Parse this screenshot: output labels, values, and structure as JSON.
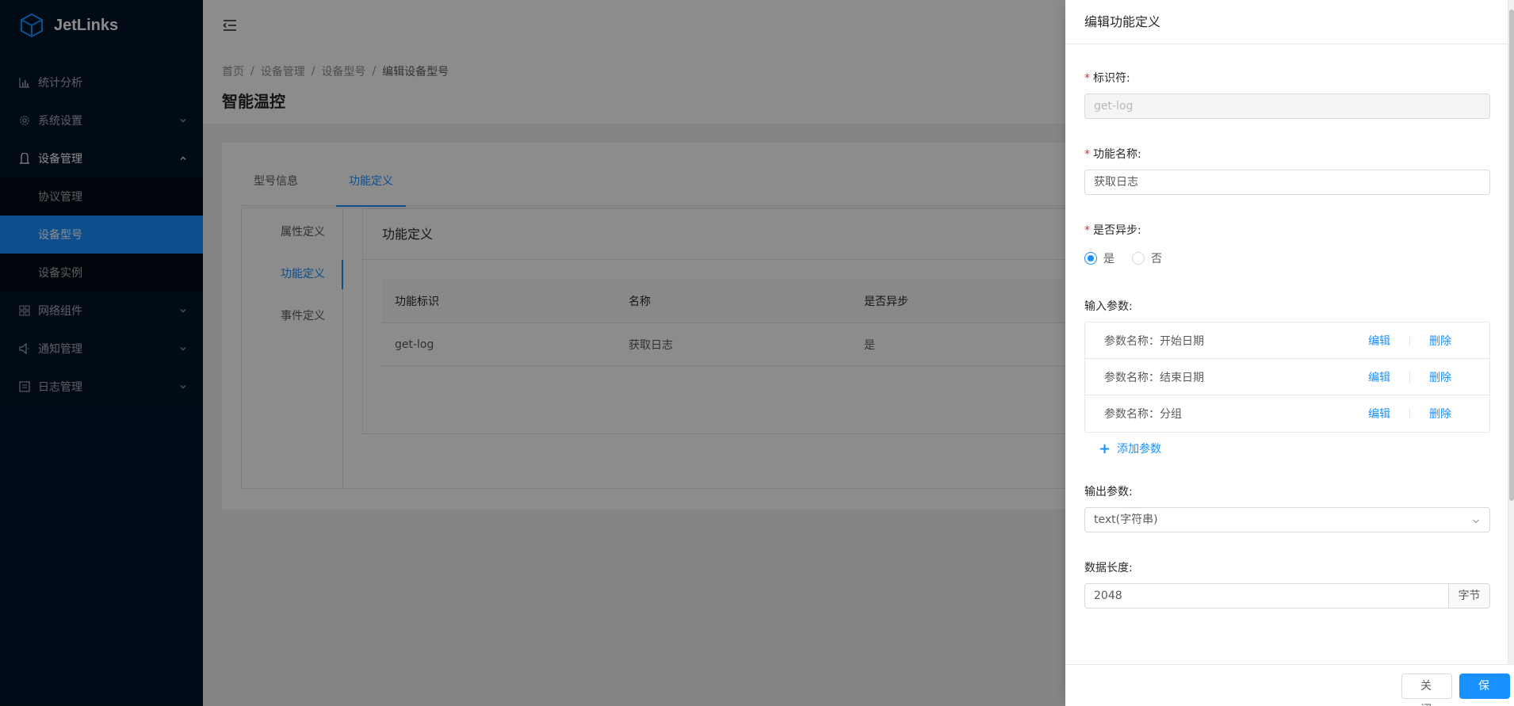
{
  "app": {
    "logo_text": "JetLinks"
  },
  "sidebar": {
    "items": [
      {
        "label": "统计分析",
        "icon": "bar-chart-icon"
      },
      {
        "label": "系统设置",
        "icon": "gear-icon"
      },
      {
        "label": "设备管理",
        "icon": "user-icon"
      },
      {
        "label": "网络组件",
        "icon": "appstore-icon"
      },
      {
        "label": "通知管理",
        "icon": "sound-icon"
      },
      {
        "label": "日志管理",
        "icon": "log-icon"
      }
    ],
    "sub_items": [
      {
        "label": "协议管理"
      },
      {
        "label": "设备型号"
      },
      {
        "label": "设备实例"
      }
    ]
  },
  "breadcrumb": [
    "首页",
    "设备管理",
    "设备型号",
    "编辑设备型号"
  ],
  "page": {
    "title": "智能温控"
  },
  "tabs": [
    "型号信息",
    "功能定义"
  ],
  "vtabs": [
    "属性定义",
    "功能定义",
    "事件定义"
  ],
  "function_card": {
    "title": "功能定义",
    "columns": [
      "功能标识",
      "名称",
      "是否异步"
    ],
    "rows": [
      {
        "id": "get-log",
        "name": "获取日志",
        "async": "是"
      }
    ]
  },
  "drawer": {
    "title": "编辑功能定义",
    "identifier": {
      "label": "标识符:",
      "value": "get-log"
    },
    "name": {
      "label": "功能名称:",
      "value": "获取日志"
    },
    "async": {
      "label": "是否异步:",
      "options": [
        "是",
        "否"
      ],
      "selected": "是"
    },
    "input_params": {
      "label": "输入参数:",
      "items": [
        {
          "label": "参数名称：开始日期"
        },
        {
          "label": "参数名称：结束日期"
        },
        {
          "label": "参数名称：分组"
        }
      ],
      "edit_label": "编辑",
      "delete_label": "删除",
      "add_label": "添加参数"
    },
    "output_params": {
      "label": "输出参数:",
      "value": "text(字符串)"
    },
    "data_length": {
      "label": "数据长度:",
      "value": "2048",
      "unit": "字节"
    },
    "buttons": {
      "close": "关 闭",
      "save": "保 存"
    }
  }
}
